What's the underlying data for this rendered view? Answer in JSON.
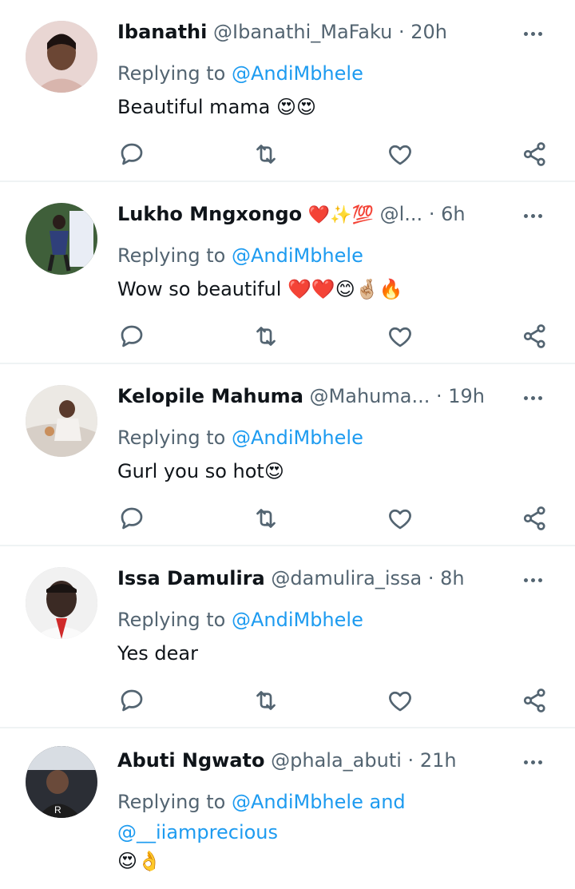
{
  "tweets": [
    {
      "name": "Ibanathi",
      "name_emoji": "",
      "handle": "@Ibanathi_MaFaku",
      "separator": "·",
      "time": "20h",
      "replying_prefix": "Replying to",
      "replying_to": "@AndiMbhele",
      "replying_and": "",
      "replying_to_second": "",
      "text": "Beautiful mama 😍😍"
    },
    {
      "name": "Lukho Mngxongo",
      "name_emoji": "❤️✨💯",
      "handle": "@l...",
      "separator": "·",
      "time": "6h",
      "replying_prefix": "Replying to",
      "replying_to": "@AndiMbhele",
      "replying_and": "",
      "replying_to_second": "",
      "text": "Wow so beautiful ❤️❤️😊🤞🏼🔥"
    },
    {
      "name": "Kelopile Mahuma",
      "name_emoji": "",
      "handle": "@Mahuma...",
      "separator": "·",
      "time": "19h",
      "replying_prefix": "Replying to",
      "replying_to": "@AndiMbhele",
      "replying_and": "",
      "replying_to_second": "",
      "text": "Gurl you so hot😍"
    },
    {
      "name": "Issa Damulira",
      "name_emoji": "",
      "handle": "@damulira_issa",
      "separator": "·",
      "time": "8h",
      "replying_prefix": "Replying to",
      "replying_to": "@AndiMbhele",
      "replying_and": "",
      "replying_to_second": "",
      "text": "Yes dear"
    },
    {
      "name": "Abuti Ngwato",
      "name_emoji": "",
      "handle": "@phala_abuti",
      "separator": "·",
      "time": "21h",
      "replying_prefix": "Replying to",
      "replying_to": "@AndiMbhele",
      "replying_and": "and",
      "replying_to_second": "@__iiamprecious",
      "text": "😍👌"
    }
  ],
  "colors": {
    "link": "#1d9bf0",
    "secondary_text": "#536471",
    "primary_text": "#0f1419",
    "divider": "#eff3f4"
  },
  "icons": {
    "more": "more-dots-icon",
    "reply": "reply-bubble-icon",
    "retweet": "retweet-icon",
    "like": "heart-icon",
    "share": "share-icon"
  }
}
